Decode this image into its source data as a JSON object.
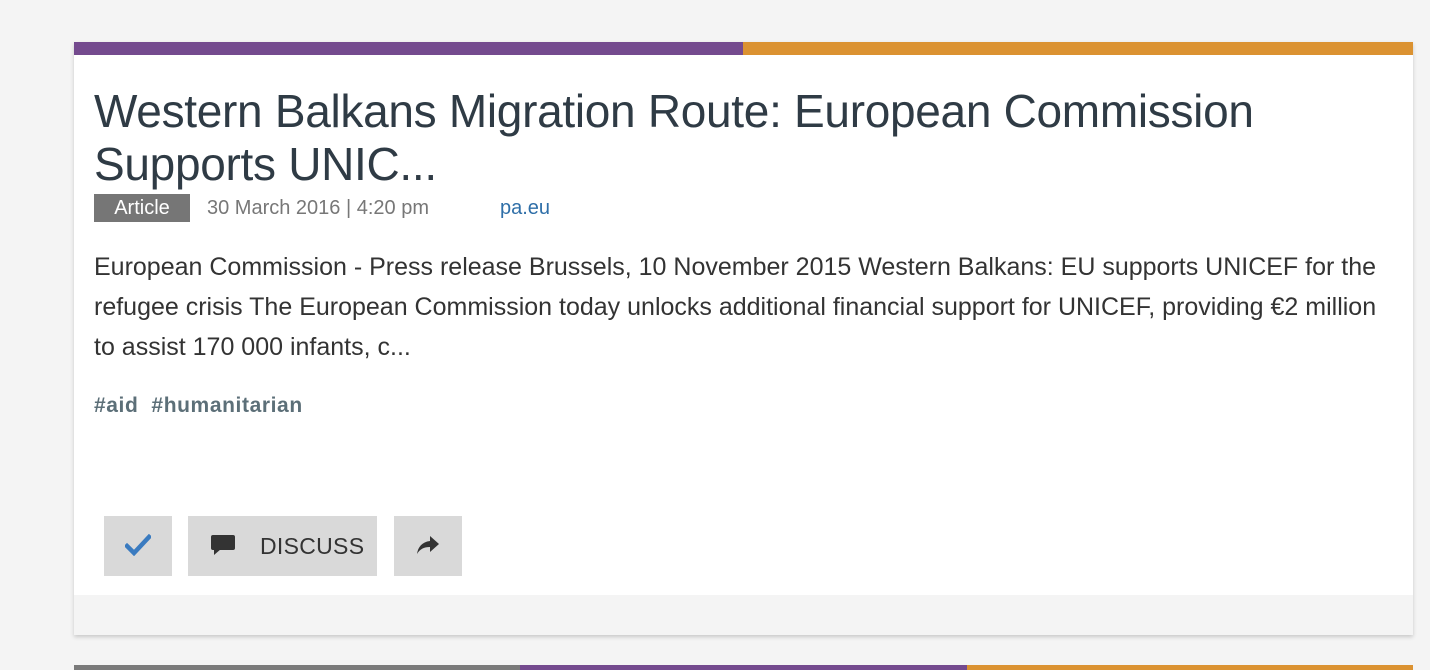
{
  "card": {
    "topbar_colors": [
      "#744a8e",
      "#db9231"
    ],
    "title": "Western Balkans Migration Route: European Commission Supports UNIC...",
    "type_badge": "Article",
    "date": "30 March 2016 | 4:20 pm",
    "source": "pa.eu",
    "excerpt": "European Commission - Press release Brussels, 10 November 2015 Western Balkans: EU supports UNICEF for the refugee crisis The European Commission today unlocks additional financial support for UNICEF, providing €2 million to assist 170 000 infants, c...",
    "tags": [
      "#aid",
      "#humanitarian"
    ],
    "actions": {
      "check_icon": "checkmark-icon",
      "discuss_icon": "comment-icon",
      "discuss_label": "DISCUSS",
      "share_icon": "share-arrow-icon"
    }
  },
  "next_card": {
    "topbar_colors": [
      "#7a7a7a",
      "#744a8e",
      "#db9231"
    ]
  },
  "colors": {
    "accent_blue": "#3a7bc0",
    "button_bg": "#d9d9d9"
  }
}
